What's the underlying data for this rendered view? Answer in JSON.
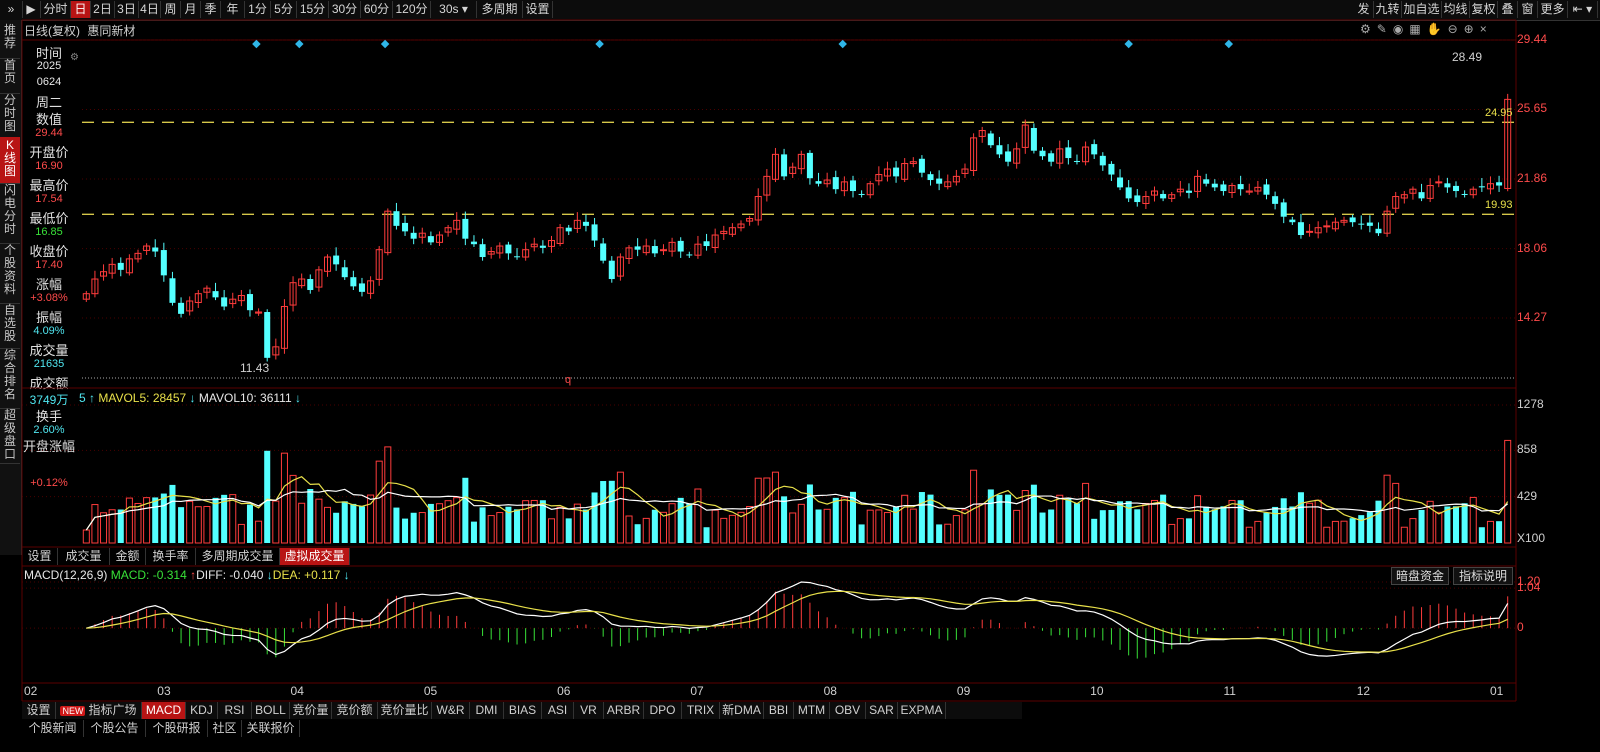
{
  "toolbar": {
    "expand": "»",
    "play": "▶",
    "periods": [
      "分时",
      "日",
      "2日",
      "3日",
      "4日",
      "周",
      "月",
      "季",
      "年",
      "1分",
      "5分",
      "15分",
      "30分",
      "60分",
      "120分",
      "30s ▾",
      "多周期",
      "设置"
    ],
    "active_period": "日",
    "right_items": [
      "发",
      "九转",
      "加自选",
      "均线",
      "复权",
      "叠",
      "窗",
      "更多",
      "⇤ ▾"
    ]
  },
  "left_nav": [
    "推荐",
    "首页",
    "分时图",
    "K线图",
    "闪电分时",
    "个股资料",
    "自选股",
    "综合排名",
    "超级盘口"
  ],
  "left_nav_active": "K线图",
  "chart_header": {
    "title": "日线(复权)",
    "stock_name": "惠同新材"
  },
  "info_panel": {
    "time_label": "时间",
    "year": "2025",
    "date": "0624",
    "weekday": "周二",
    "value_label": "数值",
    "value": "29.44",
    "open_label": "开盘价",
    "open": "16.90",
    "high_label": "最高价",
    "high": "17.54",
    "low_label": "最低价",
    "low": "16.85",
    "close_label": "收盘价",
    "close": "17.40",
    "change_label": "涨幅",
    "change": "+3.08%",
    "amp_label": "振幅",
    "amp": "4.09%",
    "vol_label": "成交量",
    "vol": "21635",
    "amount_label": "成交额",
    "amount": "3749万",
    "turnover_label": "换手",
    "turnover": "2.60%",
    "open_change_label": "开盘涨幅",
    "open_change": "+0.12%"
  },
  "price_axis": [
    "29.44",
    "25.65",
    "21.86",
    "18.06",
    "14.27"
  ],
  "price_annotations": {
    "high": "28.49",
    "line_top": "24.95",
    "line_bottom": "19.93",
    "low": "11.43",
    "q_marker": "q"
  },
  "volume_header": {
    "left": "5 ↑",
    "mavol5": "MAVOL5: 28457",
    "mavol5_arrow": "↓",
    "mavol10": "MAVOL10: 36111",
    "mavol10_arrow": "↓"
  },
  "volume_axis": [
    "1278",
    "858",
    "429"
  ],
  "volume_unit": "X100",
  "volume_tabs": [
    "设置",
    "成交量",
    "金额",
    "换手率",
    "多周期成交量",
    "虚拟成交量"
  ],
  "volume_tab_active": "虚拟成交量",
  "macd_header": {
    "name": "MACD(12,26,9)",
    "macd": "MACD: -0.314",
    "diff": "DIFF: -0.040",
    "dea": "DEA: +0.117"
  },
  "macd_buttons": [
    "暗盘资金",
    "指标说明"
  ],
  "macd_axis": [
    "1.20",
    "1.04",
    "0"
  ],
  "months": [
    "02",
    "03",
    "04",
    "05",
    "06",
    "07",
    "08",
    "09",
    "10",
    "11",
    "12",
    "01"
  ],
  "indicator_tabs": [
    "设置",
    "指标广场",
    "MACD",
    "KDJ",
    "RSI",
    "BOLL",
    "竞价量",
    "竞价额",
    "竞价量比",
    "W&R",
    "DMI",
    "BIAS",
    "ASI",
    "VR",
    "ARBR",
    "DPO",
    "TRIX",
    "新DMA",
    "BBI",
    "MTM",
    "OBV",
    "SAR",
    "EXPMA"
  ],
  "indicator_tab_active": "MACD",
  "new_badge": "NEW",
  "bottom_tabs": [
    "个股新闻",
    "个股公告",
    "个股研报",
    "社区",
    "关联报价"
  ],
  "chart_data": {
    "type": "candlestick",
    "y_range": [
      11.0,
      29.44
    ],
    "horizontal_lines": [
      24.95,
      19.93
    ],
    "closes": [
      15.6,
      16.4,
      16.8,
      17.2,
      16.9,
      17.5,
      17.8,
      18.2,
      17.9,
      16.6,
      15.1,
      14.5,
      15.2,
      15.6,
      15.9,
      15.4,
      14.9,
      15.3,
      15.5,
      14.7,
      14.6,
      12.1,
      12.7,
      14.9,
      16.2,
      16.4,
      15.8,
      16.9,
      17.6,
      17.2,
      16.5,
      16.0,
      15.7,
      16.3,
      18.0,
      20.1,
      19.3,
      19.0,
      18.6,
      18.9,
      18.4,
      18.8,
      19.2,
      19.6,
      18.6,
      18.3,
      17.6,
      17.9,
      18.2,
      17.8,
      17.6,
      18.0,
      18.3,
      18.1,
      18.5,
      19.2,
      19.0,
      19.6,
      19.3,
      18.5,
      17.4,
      16.4,
      17.6,
      18.1,
      18.0,
      18.2,
      17.8,
      18.0,
      18.4,
      17.9,
      17.7,
      18.3,
      18.2,
      18.8,
      19.0,
      19.2,
      19.4,
      19.7,
      20.9,
      22.0,
      23.2,
      22.0,
      22.5,
      23.2,
      21.9,
      21.6,
      21.8,
      21.3,
      21.7,
      21.2,
      21.0,
      21.6,
      22.1,
      22.4,
      22.0,
      22.7,
      22.8,
      22.2,
      21.8,
      21.6,
      21.7,
      22.0,
      22.4,
      24.1,
      24.5,
      23.7,
      23.2,
      22.8,
      23.5,
      24.8,
      23.4,
      23.1,
      22.8,
      23.5,
      23.0,
      22.8,
      23.6,
      23.2,
      22.6,
      22.1,
      21.4,
      20.8,
      20.6,
      20.9,
      21.2,
      20.8,
      21.0,
      21.3,
      21.1,
      22.0,
      21.6,
      21.4,
      21.2,
      21.5,
      21.3,
      21.2,
      21.4,
      21.0,
      20.5,
      19.8,
      19.5,
      18.8,
      19.0,
      19.2,
      19.3,
      19.5,
      19.6,
      19.5,
      19.4,
      19.3,
      18.9,
      20.1,
      20.9,
      21.0,
      21.3,
      20.8,
      21.5,
      21.7,
      21.4,
      21.2,
      21.0,
      21.3,
      21.4,
      21.6,
      21.5,
      26.2
    ],
    "macd_range": [
      -1.4,
      1.2
    ],
    "volume_range": [
      0,
      1278
    ],
    "months": [
      "02",
      "03",
      "04",
      "05",
      "06",
      "07",
      "08",
      "09",
      "10",
      "11",
      "12",
      "01"
    ]
  }
}
